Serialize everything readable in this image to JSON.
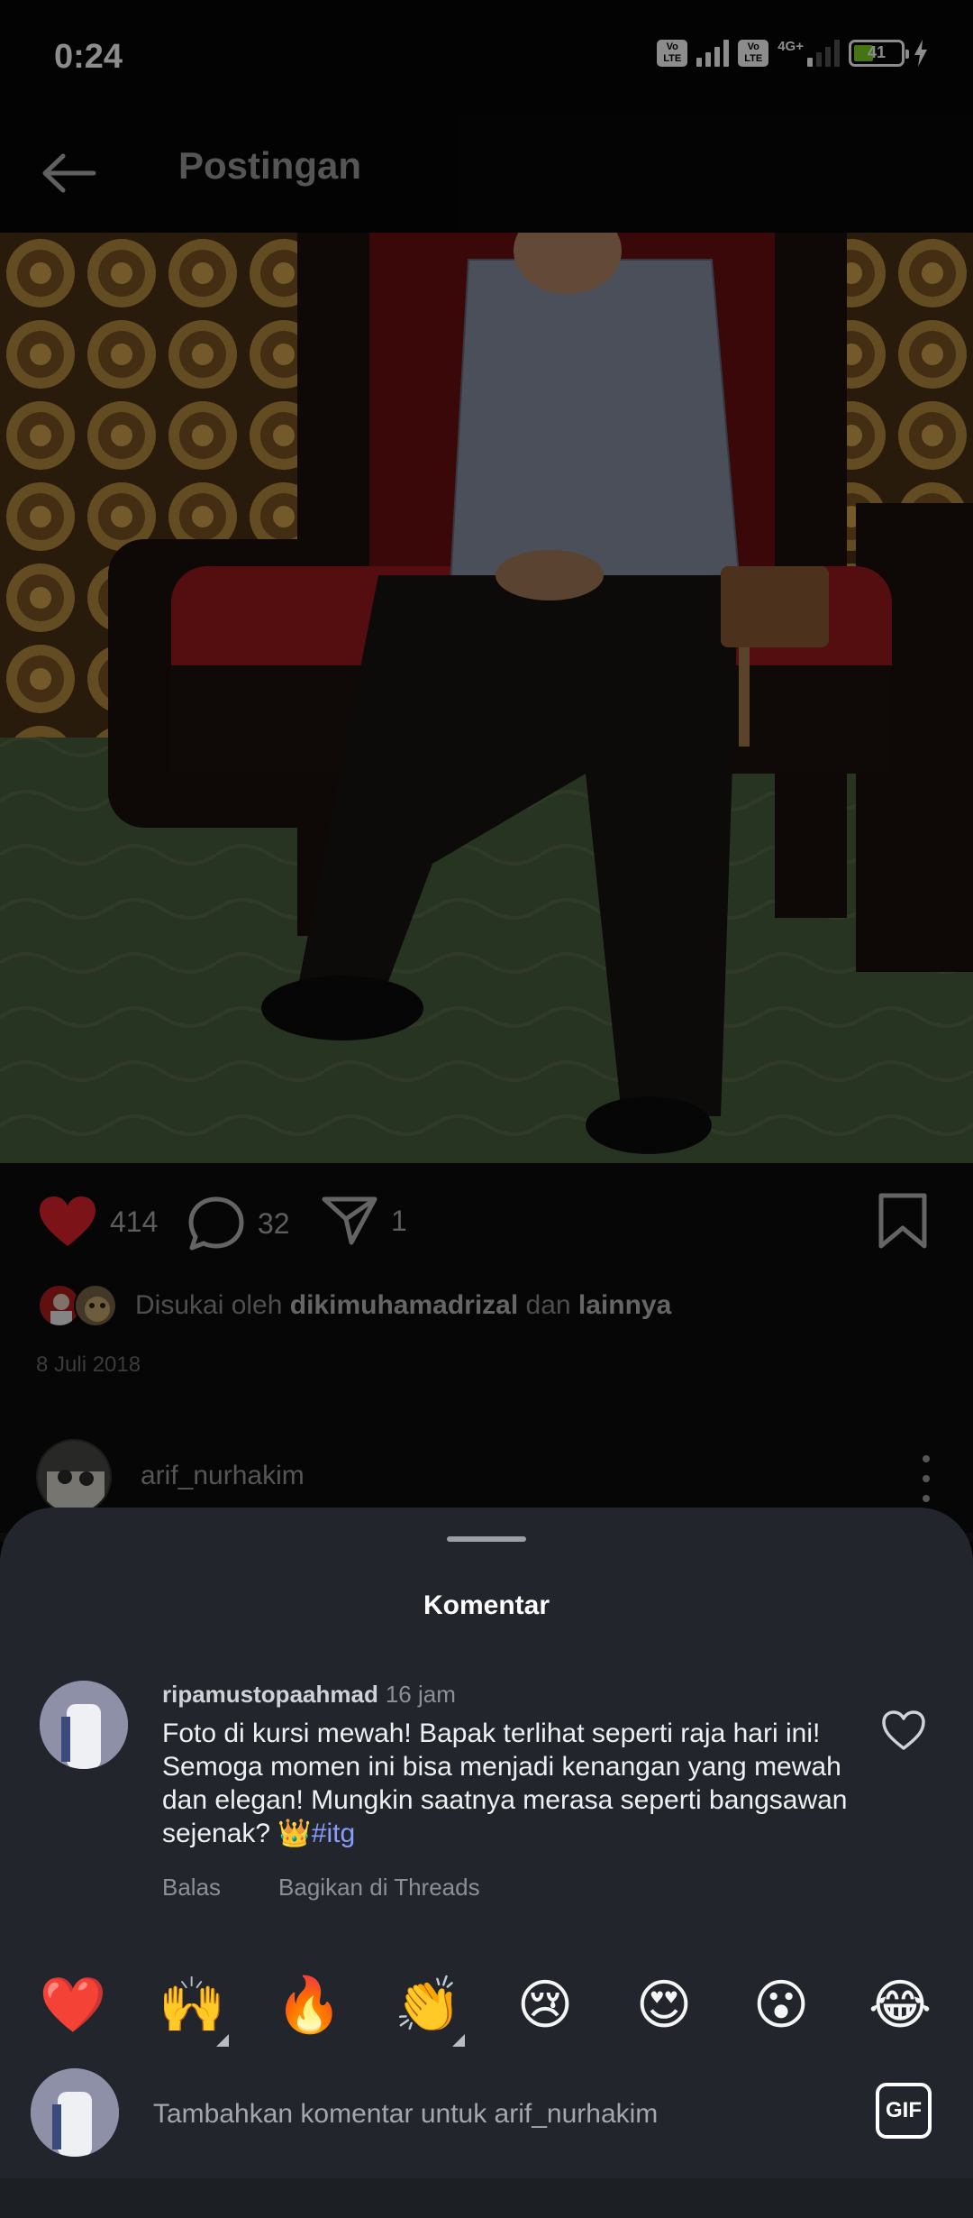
{
  "status_bar": {
    "time": "0:24",
    "volte_1": "Vo LTE",
    "volte_2": "Vo LTE",
    "network": "4G+",
    "battery": "41",
    "battery_fraction": 0.41,
    "battery_color": "#7ed321"
  },
  "app_bar": {
    "back_icon": "arrow-left-icon",
    "title": "Postingan"
  },
  "post": {
    "like_count": "414",
    "comment_count": "32",
    "share_count": "1",
    "liked_by_prefix": "Disukai oleh ",
    "liked_by_user": "dikimuhamadrizal",
    "liked_by_middle": " dan ",
    "liked_by_others": "lainnya",
    "date": "8 Juli 2018",
    "author": "arif_nurhakim",
    "like_color": "#e0242f"
  },
  "comments_sheet": {
    "title": "Komentar",
    "comment": {
      "username": "ripamustopaahmad",
      "time": "16 jam",
      "text": "Foto di kursi mewah! Bapak terlihat seperti raja  hari ini! Semoga momen ini bisa menjadi kenangan yang mewah dan elegan! Mungkin saatnya merasa seperti bangsawan sejenak? 👑",
      "hashtag": "#itg",
      "reply_label": "Balas",
      "share_threads_label": "Bagikan di Threads"
    },
    "quick_emojis": [
      "❤️",
      "🙌",
      "🔥",
      "👏",
      "😢",
      "😍",
      "😮",
      "😂"
    ],
    "compose_placeholder": "Tambahkan komentar untuk arif_nurhakim",
    "gif_label": "GIF"
  }
}
